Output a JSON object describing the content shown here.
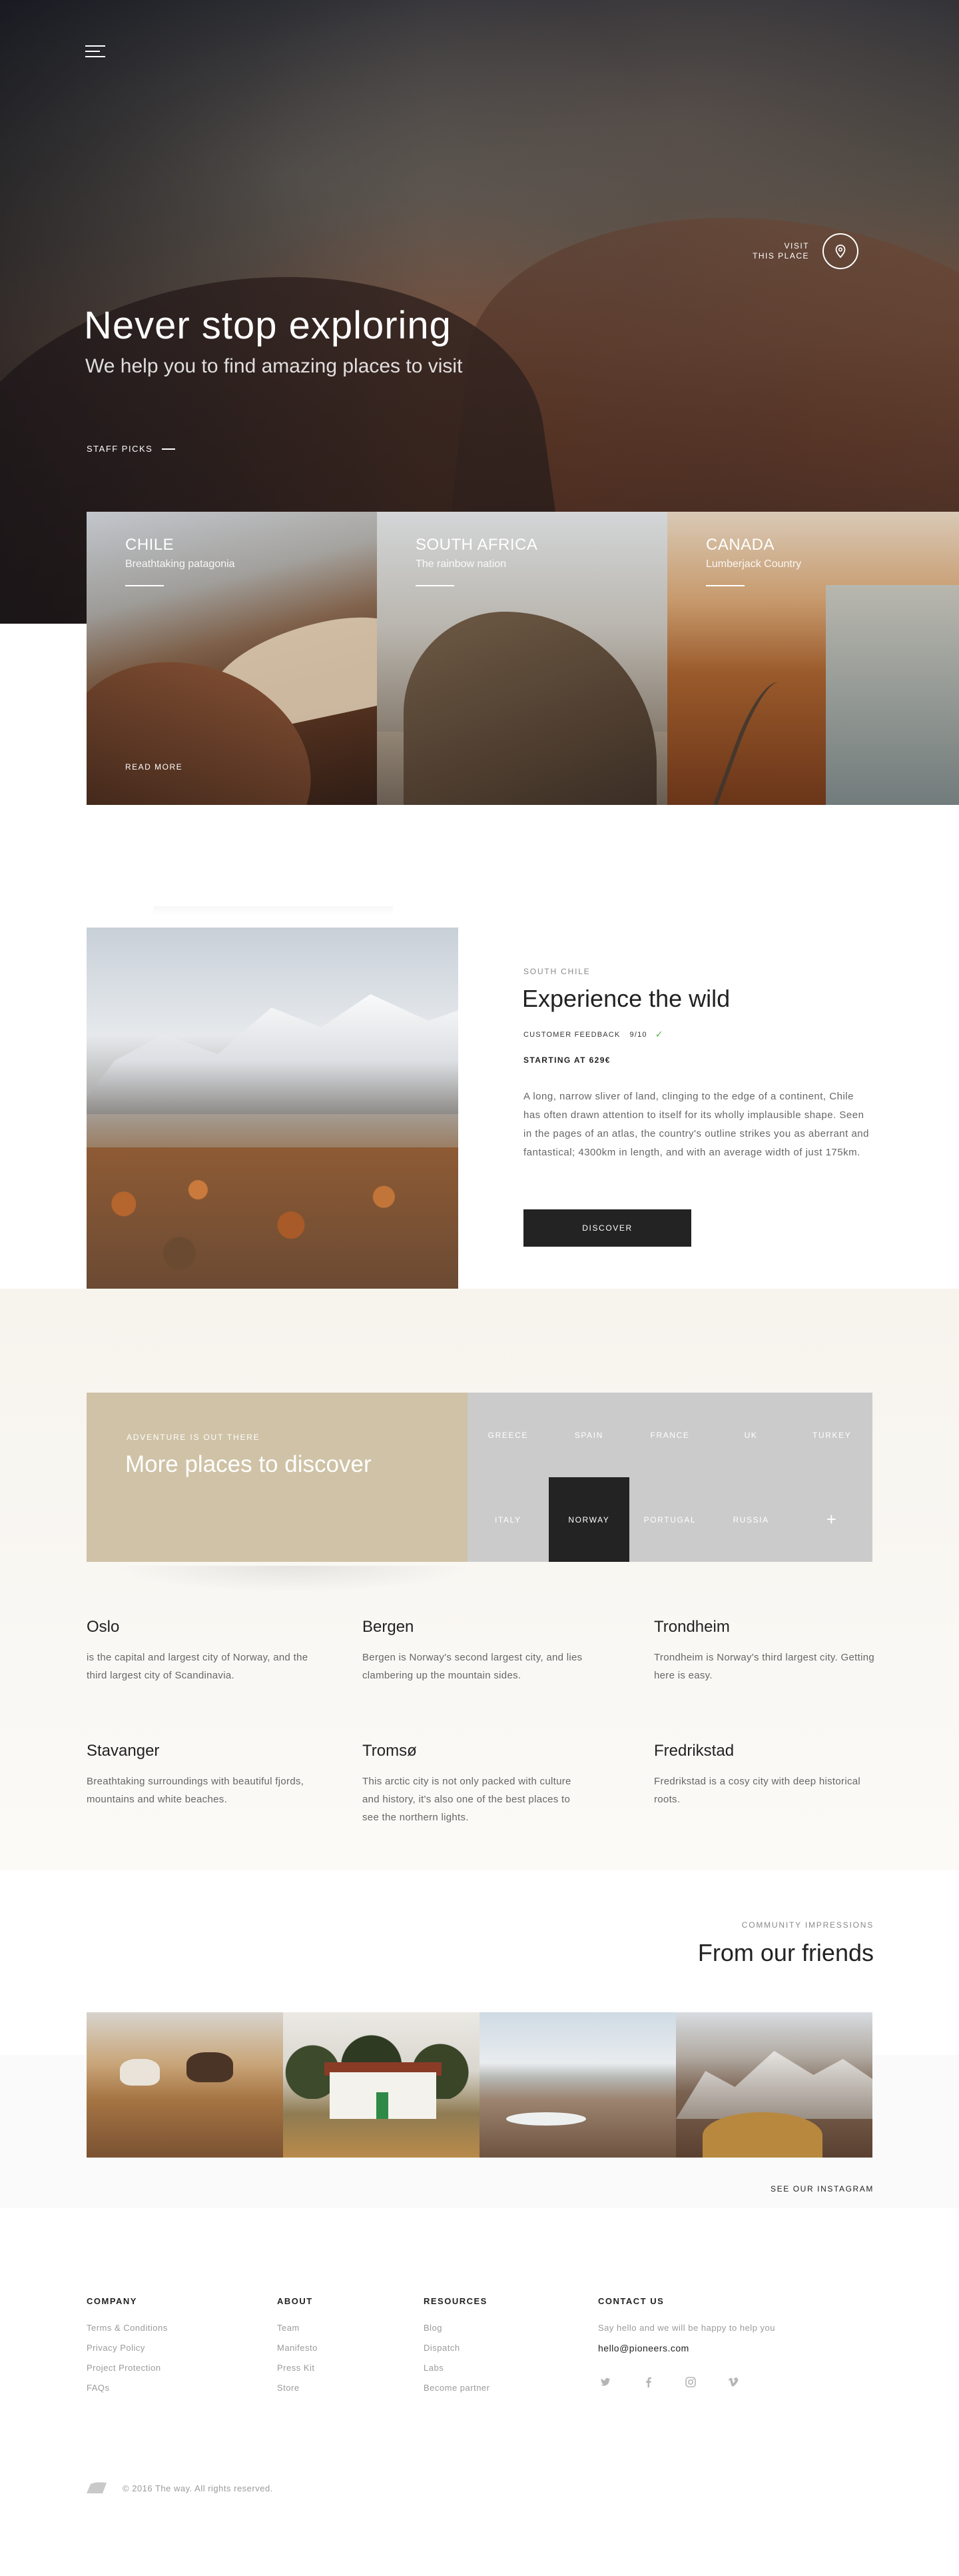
{
  "hero": {
    "title": "Never stop exploring",
    "subtitle": "We help you to find amazing places to visit",
    "staff_picks": "STAFF PICKS",
    "visit_line1": "VISIT",
    "visit_line2": "THIS PLACE"
  },
  "cards": [
    {
      "name": "CHILE",
      "desc": "Breathtaking patagonia",
      "cta": "READ MORE"
    },
    {
      "name": "SOUTH AFRICA",
      "desc": "The rainbow nation"
    },
    {
      "name": "CANADA",
      "desc": "Lumberjack Country"
    }
  ],
  "experience": {
    "eyebrow": "SOUTH CHILE",
    "title": "Experience the wild",
    "feedback_label": "CUSTOMER FEEDBACK",
    "feedback_score": "9/10",
    "starting": "STARTING AT 629€",
    "body": "A long, narrow sliver of land, clinging to the edge of a continent, Chile has often drawn attention to itself for its wholly implausible shape. Seen in the pages of an atlas, the country's outline strikes you as aberrant and fantastical; 4300km in length, and with an average width of just 175km.",
    "button": "DISCOVER"
  },
  "discover": {
    "eyebrow": "ADVENTURE IS OUT THERE",
    "title": "More places to discover",
    "countries": [
      "GREECE",
      "SPAIN",
      "FRANCE",
      "UK",
      "TURKEY",
      "ITALY",
      "NORWAY",
      "PORTUGAL",
      "RUSSIA",
      "+"
    ],
    "active_country": "NORWAY"
  },
  "cities": [
    {
      "name": "Oslo",
      "desc": "is the capital and largest city of Norway, and the third largest city of Scandinavia."
    },
    {
      "name": "Bergen",
      "desc": "Bergen is Norway's second largest city, and lies clambering up the mountain sides."
    },
    {
      "name": "Trondheim",
      "desc": "Trondheim is Norway's third largest city. Getting here is easy."
    },
    {
      "name": "Stavanger",
      "desc": "Breathtaking surroundings with beautiful fjords, mountains and white beaches."
    },
    {
      "name": "Tromsø",
      "desc": "This arctic city is not only packed with culture and history, it's also one of the best places to see the northern lights."
    },
    {
      "name": "Fredrikstad",
      "desc": "Fredrikstad is a cosy city with deep historical roots."
    }
  ],
  "friends": {
    "eyebrow": "COMMUNITY IMPRESSIONS",
    "title": "From our friends",
    "see_instagram": "SEE OUR INSTAGRAM"
  },
  "footer": {
    "company": {
      "heading": "COMPANY",
      "links": [
        "Terms & Conditions",
        "Privacy Policy",
        "Project Protection",
        "FAQs"
      ]
    },
    "about": {
      "heading": "ABOUT",
      "links": [
        "Team",
        "Manifesto",
        "Press Kit",
        "Store"
      ]
    },
    "resources": {
      "heading": "RESOURCES",
      "links": [
        "Blog",
        "Dispatch",
        "Labs",
        "Become partner"
      ]
    },
    "contact": {
      "heading": "CONTACT US",
      "text": "Say hello and we will be happy to help you",
      "email": "hello@pioneers.com"
    },
    "socials": [
      "twitter-icon",
      "facebook-icon",
      "instagram-icon",
      "vimeo-icon"
    ],
    "copyright": "© 2016 The way. All rights reserved."
  },
  "colors": {
    "accent_dark": "#232323",
    "discover_panel": "#cfc2a6",
    "country_grid": "#cbcbcb",
    "feedback_check": "#55b04a"
  }
}
